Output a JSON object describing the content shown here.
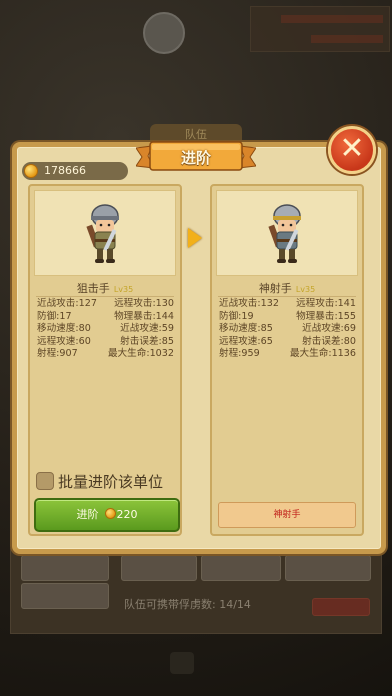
{
  "dialog": {
    "title": "进阶",
    "team_tab": "队伍",
    "gold": "178666",
    "close_symbol": "✕"
  },
  "left_unit": {
    "name": "狙击手",
    "level": "Lv35",
    "stats": [
      [
        "近战攻击:127",
        "远程攻击:130"
      ],
      [
        "防御:17",
        "物理暴击:144"
      ],
      [
        "移动速度:80",
        "近战攻速:59"
      ],
      [
        "远程攻速:60",
        "射击误差:85"
      ],
      [
        "射程:907",
        "最大生命:1032"
      ]
    ]
  },
  "right_unit": {
    "name": "神射手",
    "level": "Lv35",
    "stats": [
      [
        "近战攻击:132",
        "远程攻击:141"
      ],
      [
        "防御:19",
        "物理暴击:155"
      ],
      [
        "移动速度:85",
        "近战攻速:69"
      ],
      [
        "远程攻速:65",
        "射击误差:80"
      ],
      [
        "射程:959",
        "最大生命:1136"
      ]
    ]
  },
  "controls": {
    "batch_label": "批量进阶该单位",
    "advance_label": "进阶",
    "advance_cost": "220",
    "target_button": "神射手"
  },
  "background": {
    "troop_count_text": "队伍可携带俘虏数: 14/14"
  },
  "colors": {
    "panel": "#e9d8a6",
    "border": "#c79a4c",
    "advance_green": "#6aa82a",
    "close_red": "#d8441f",
    "level_gold": "#c4a52a"
  }
}
